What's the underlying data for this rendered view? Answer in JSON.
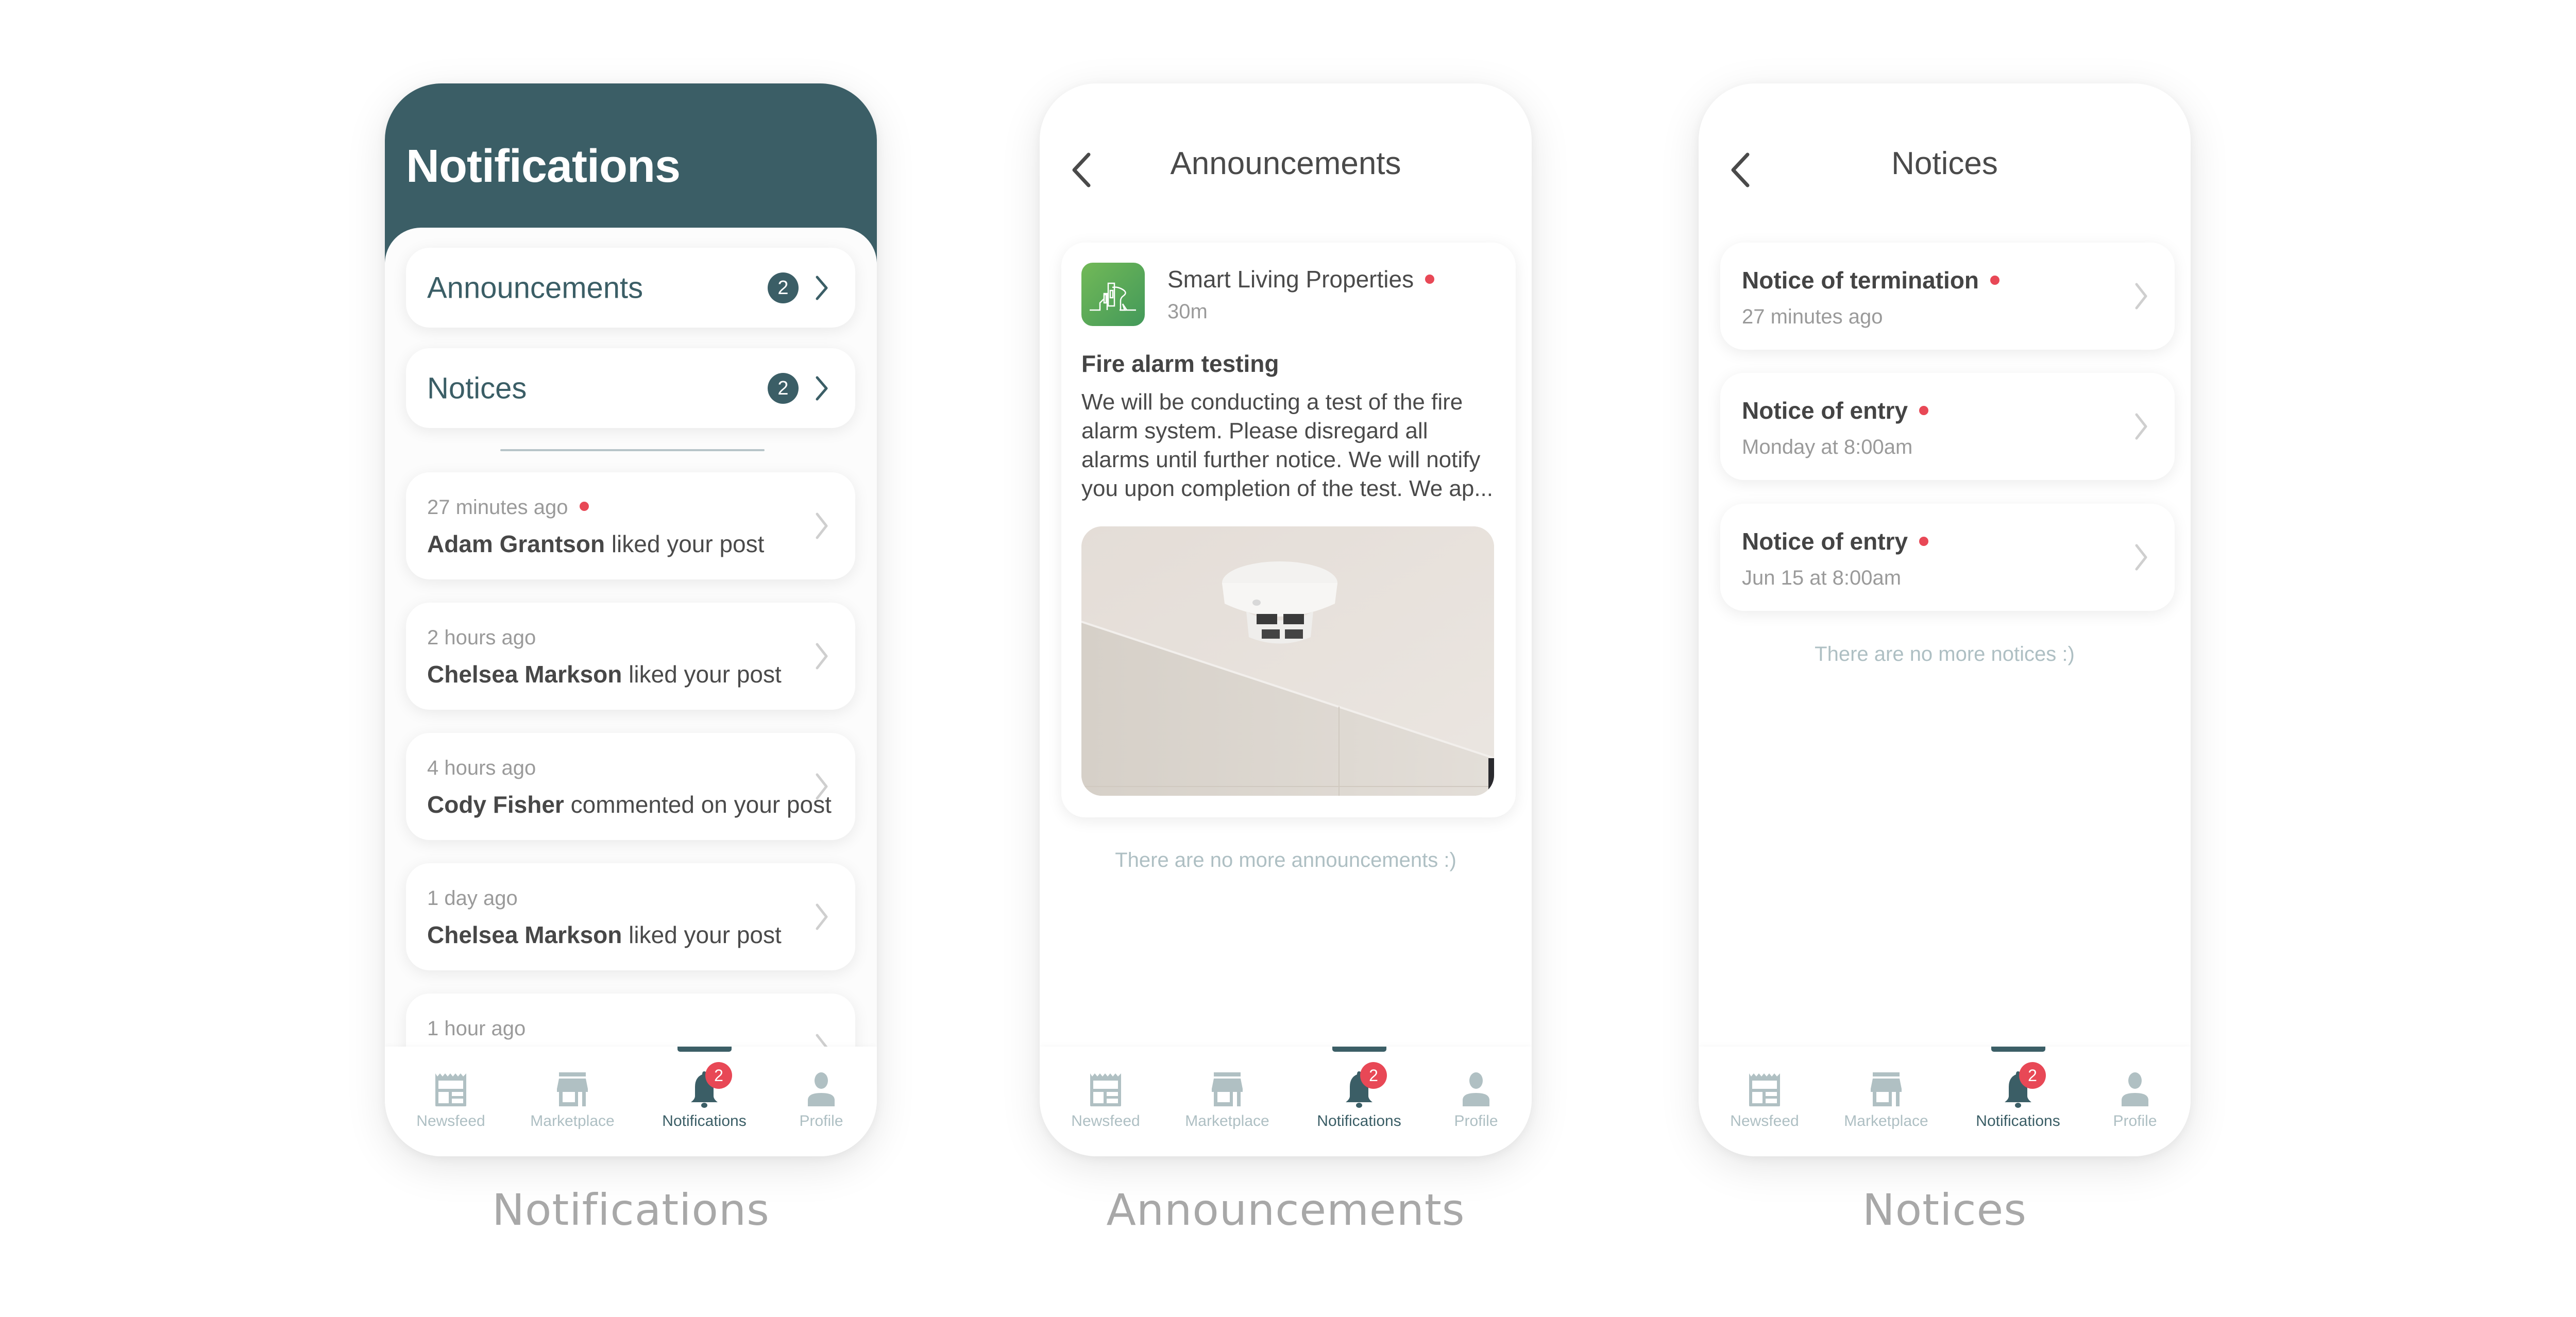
{
  "colors": {
    "primary": "#3b5e66",
    "accent_red": "#e84856",
    "muted": "#aebfc3",
    "text": "#4a4a4a",
    "secondary_text": "#9a9a9a",
    "logo_green": "#5aab57"
  },
  "captions": [
    "Notifications",
    "Announcements",
    "Notices"
  ],
  "bottom_nav": {
    "items": [
      {
        "label": "Newsfeed",
        "icon": "newspaper-icon"
      },
      {
        "label": "Marketplace",
        "icon": "storefront-icon"
      },
      {
        "label": "Notifications",
        "icon": "bell-icon",
        "active": true,
        "badge": "2"
      },
      {
        "label": "Profile",
        "icon": "person-icon"
      }
    ]
  },
  "notifications_screen": {
    "title": "Notifications",
    "categories": [
      {
        "label": "Announcements",
        "count": "2"
      },
      {
        "label": "Notices",
        "count": "2"
      }
    ],
    "items": [
      {
        "time": "27 minutes ago",
        "unread": true,
        "name": "Adam Grantson",
        "action": "liked your post"
      },
      {
        "time": "2 hours ago",
        "unread": false,
        "name": "Chelsea Markson",
        "action": "liked your post"
      },
      {
        "time": "4 hours ago",
        "unread": false,
        "name": "Cody Fisher",
        "action": "commented on your post"
      },
      {
        "time": "1 day ago",
        "unread": false,
        "name": "Chelsea Markson",
        "action": "liked your post"
      },
      {
        "time": "1 hour ago",
        "unread": false,
        "name": "",
        "action": ""
      }
    ]
  },
  "announcements_screen": {
    "title": "Announcements",
    "announcement": {
      "sender": "Smart Living Properties",
      "unread": true,
      "time": "30m",
      "subject": "Fire alarm testing",
      "body": "We will be conducting a test of the fire alarm system. Please disregard all alarms until further notice. We will notify you upon completion of the test. We ap...",
      "image_alt": "ceiling-mounted smoke detector"
    },
    "end_message": "There are no more announcements :)"
  },
  "notices_screen": {
    "title": "Notices",
    "items": [
      {
        "title": "Notice of termination",
        "unread": true,
        "subtitle": "27 minutes ago"
      },
      {
        "title": "Notice of entry",
        "unread": true,
        "subtitle": "Monday at 8:00am"
      },
      {
        "title": "Notice of entry",
        "unread": true,
        "subtitle": "Jun 15 at 8:00am"
      }
    ],
    "end_message": "There are no more notices :)"
  }
}
